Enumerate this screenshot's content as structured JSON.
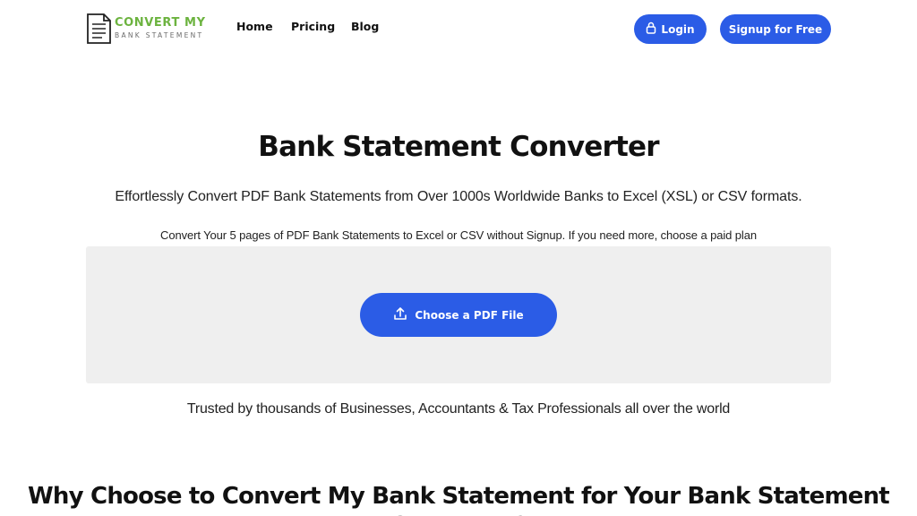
{
  "header": {
    "logo": {
      "line1": "CONVERT MY",
      "line2": "BANK STATEMENT"
    },
    "nav": [
      {
        "label": "Home"
      },
      {
        "label": "Pricing"
      },
      {
        "label": "Blog"
      }
    ],
    "login_label": "Login",
    "signup_label": "Signup for Free"
  },
  "hero": {
    "title": "Bank Statement Converter",
    "subtitle": "Effortlessly Convert PDF Bank Statements from Over 1000s Worldwide Banks to Excel (XSL) or CSV formats.",
    "note": "Convert Your 5 pages of PDF Bank Statements to Excel or CSV without Signup. If you need more, choose a paid plan",
    "upload_label": "Choose a PDF File",
    "trusted": "Trusted by thousands of Businesses, Accountants & Tax Professionals all over the world"
  },
  "why": {
    "title": "Why Choose to Convert My Bank Statement for Your Bank Statement Converter?"
  },
  "colors": {
    "accent": "#2b5ce6",
    "logo_green": "#6cb33f",
    "upload_bg": "#efefef"
  },
  "icons": {
    "logo": "document-icon",
    "login": "lock-icon",
    "upload": "upload-icon"
  }
}
